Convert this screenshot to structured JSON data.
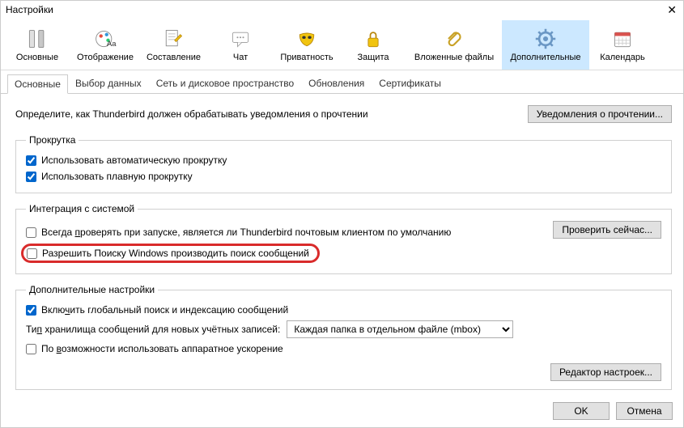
{
  "title": "Настройки",
  "toolbar": {
    "items": [
      {
        "label": "Основные"
      },
      {
        "label": "Отображение"
      },
      {
        "label": "Составление"
      },
      {
        "label": "Чат"
      },
      {
        "label": "Приватность"
      },
      {
        "label": "Защита"
      },
      {
        "label": "Вложенные файлы"
      },
      {
        "label": "Дополнительные"
      },
      {
        "label": "Календарь"
      }
    ]
  },
  "tabs": [
    "Основные",
    "Выбор данных",
    "Сеть и дисковое пространство",
    "Обновления",
    "Сертификаты"
  ],
  "intro": "Определите, как Thunderbird должен обрабатывать уведомления о прочтении",
  "notif_button": "Уведомления о прочтении...",
  "scroll": {
    "legend": "Прокрутка",
    "auto": "Использовать автоматическую прокрутку",
    "smooth": "Использовать плавную прокрутку"
  },
  "integration": {
    "legend": "Интеграция с системой",
    "check_default_pre": "Всегда ",
    "check_default_u": "п",
    "check_default_post": "роверять при запуске, является ли Thunderbird почтовым клиентом по умолчанию",
    "check_now": "Проверить сейчас...",
    "windows_search": "Разрешить Поиску Windows производить поиск сообщений"
  },
  "extra": {
    "legend": "Дополнительные настройки",
    "global_pre": "Вклю",
    "global_u": "ч",
    "global_post": "ить глобальный поиск и индексацию сообщений",
    "storage_label_pre": "Ти",
    "storage_label_u": "п",
    "storage_label_post": " хранилища сообщений для новых учётных записей:",
    "storage_value": "Каждая папка в отдельном файле (mbox)",
    "hw_pre": "По ",
    "hw_u": "в",
    "hw_post": "озможности использовать аппаратное ускорение",
    "editor_button": "Редактор настроек..."
  },
  "footer": {
    "ok": "OK",
    "cancel": "Отмена"
  }
}
